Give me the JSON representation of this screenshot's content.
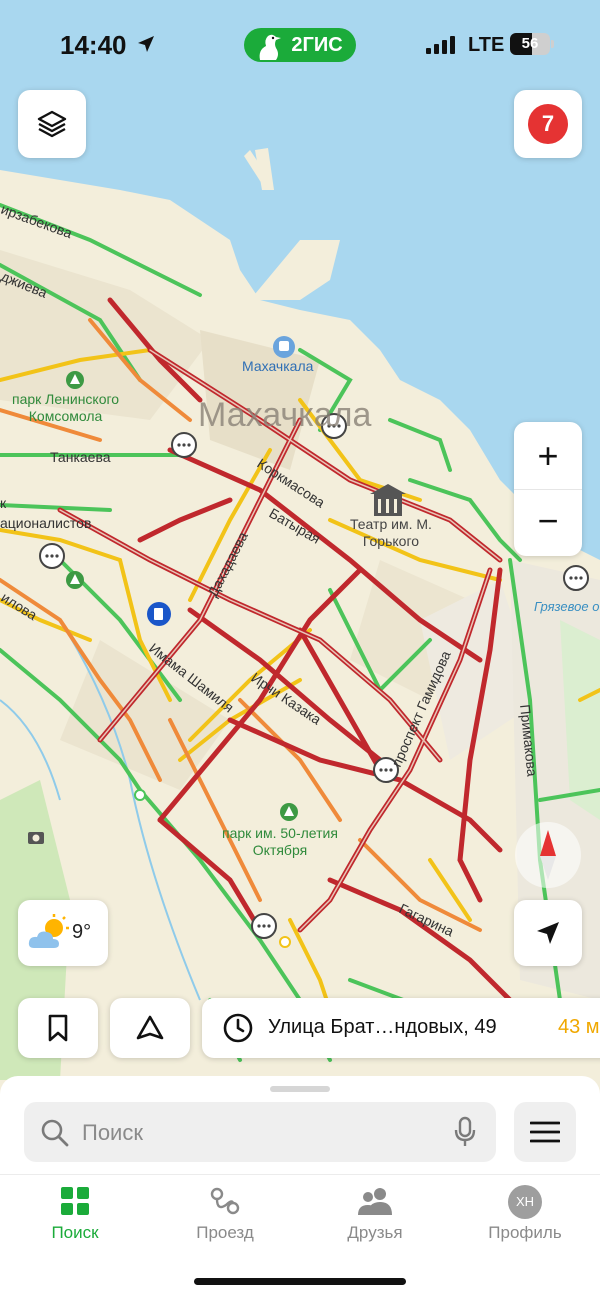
{
  "status": {
    "time": "14:40",
    "brand": "2ГИС",
    "network": "LTE",
    "battery_text": "56",
    "battery_level": 0.56
  },
  "map": {
    "city_label": "Махачкала",
    "labels": {
      "station": "Махачкала",
      "park_lenin_line1": "парк Ленинского",
      "park_lenin_line2": "Комсомола",
      "street_tankaeva": "Танкаева",
      "street_nationalists": "ационалистов",
      "theatre_line1": "Театр им. М.",
      "theatre_line2": "Горького",
      "street_korkmasova": "Коркмасова",
      "street_batyraya": "Батырая",
      "street_dahadaeva": "Дахадаева",
      "street_imama": "Имама Шамиля",
      "street_irchi": "Ирчи Казака",
      "street_hamidova": "проспект Гамидова",
      "street_primakova": "Примакова",
      "street_gagarina": "Гагарина",
      "park50_line1": "парк им. 50-летия",
      "park50_line2": "Октября",
      "lake": "Грязевое о",
      "edge_top1": "ирзабекова",
      "edge_top2": "джиева",
      "edge_left1": "к",
      "edge_left2": "илова"
    },
    "notifications_count": "7"
  },
  "controls": {
    "zoom_in": "+",
    "zoom_out": "−"
  },
  "weather": {
    "temperature": "9°",
    "icon": "partly-cloudy-icon"
  },
  "route_pill": {
    "address": "Улица Брат…ндовых, 49",
    "distance": "43 м"
  },
  "search": {
    "placeholder": "Поиск"
  },
  "tabs": [
    {
      "label": "Поиск",
      "icon": "grid-icon",
      "active": true
    },
    {
      "label": "Проезд",
      "icon": "route-icon",
      "active": false
    },
    {
      "label": "Друзья",
      "icon": "friends-icon",
      "active": false
    },
    {
      "label": "Профиль",
      "icon": "avatar",
      "avatar_text": "ХН",
      "active": false
    }
  ],
  "colors": {
    "brand_green": "#1bab3a",
    "traffic_red": "#c0282d",
    "traffic_yellow": "#f2c318",
    "traffic_green": "#4cc45a",
    "sea": "#a9d7ef",
    "badge_red": "#e53333"
  }
}
